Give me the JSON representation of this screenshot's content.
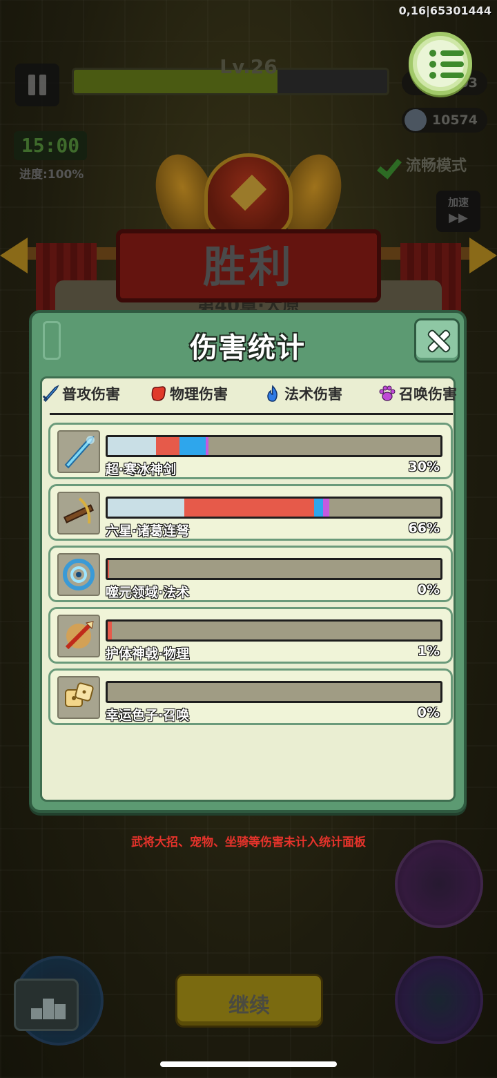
{
  "status": {
    "version": "0,16|65301444"
  },
  "hud": {
    "level": "Lv.26",
    "level_progress_fraction": 0.65,
    "coins": "5203",
    "kills": "10574",
    "timer": "15:00",
    "progress": "进度:100%",
    "smooth_mode": "流畅模式",
    "speed_label": "加速",
    "speed_icon": "▶▶"
  },
  "victory": {
    "title": "胜利",
    "chapter": "第40章·大原"
  },
  "dialog": {
    "title": "伤害统计",
    "legend": [
      {
        "label": "普攻伤害",
        "icon": "sword-icon",
        "color": "#3a8ee0"
      },
      {
        "label": "物理伤害",
        "icon": "fist-icon",
        "color": "#e03a2a"
      },
      {
        "label": "法术伤害",
        "icon": "flame-icon",
        "color": "#2f7be6"
      },
      {
        "label": "召唤伤害",
        "icon": "paw-icon",
        "color": "#c04ad6"
      }
    ],
    "items": [
      {
        "name": "超·寒冰神剑",
        "percent": "30%",
        "icon": "ice-sword-icon",
        "segments": [
          {
            "type": "普攻伤害",
            "share": 0.145,
            "color": "#c9dfe6"
          },
          {
            "type": "物理伤害",
            "share": 0.07,
            "color": "#e65a4a"
          },
          {
            "type": "法术伤害",
            "share": 0.08,
            "color": "#2ea6ec"
          },
          {
            "type": "召唤伤害",
            "share": 0.008,
            "color": "#c45ae0"
          }
        ]
      },
      {
        "name": "六星·诸葛连弩",
        "percent": "66%",
        "icon": "crossbow-icon",
        "segments": [
          {
            "type": "普攻伤害",
            "share": 0.23,
            "color": "#c9dfe6"
          },
          {
            "type": "物理伤害",
            "share": 0.39,
            "color": "#e65a4a"
          },
          {
            "type": "法术伤害",
            "share": 0.028,
            "color": "#2ea6ec"
          },
          {
            "type": "召唤伤害",
            "share": 0.018,
            "color": "#c45ae0"
          }
        ]
      },
      {
        "name": "噬元领域·法术",
        "percent": "0%",
        "icon": "vortex-icon",
        "segments": [
          {
            "type": "物理伤害",
            "share": 0.004,
            "color": "#e65a4a"
          }
        ]
      },
      {
        "name": "护体神戟·物理",
        "percent": "1%",
        "icon": "halberd-icon",
        "segments": [
          {
            "type": "物理伤害",
            "share": 0.012,
            "color": "#e65a4a"
          }
        ]
      },
      {
        "name": "幸运色子·召唤",
        "percent": "0%",
        "icon": "dice-icon",
        "segments": []
      }
    ]
  },
  "notice": "武将大招、宠物、坐骑等伤害未计入统计面板",
  "buttons": {
    "continue": "继续"
  }
}
